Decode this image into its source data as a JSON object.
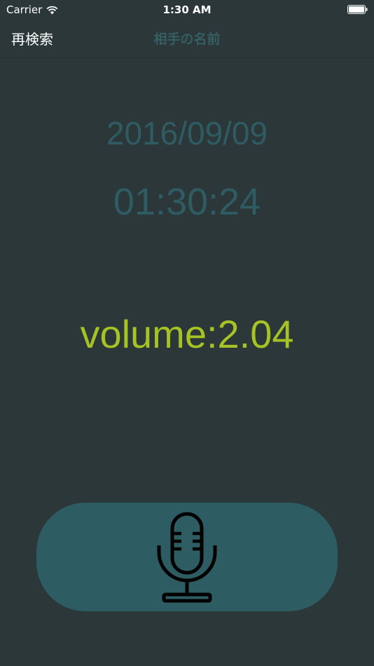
{
  "status_bar": {
    "carrier": "Carrier",
    "time": "1:30 AM",
    "wifi_icon": "wifi-icon",
    "battery_icon": "battery-icon"
  },
  "nav_bar": {
    "back_label": "再検索",
    "title": "相手の名前"
  },
  "main": {
    "date": "2016/09/09",
    "time": "01:30:24",
    "volume": "volume:2.04"
  },
  "record_button": {
    "icon": "microphone-icon"
  },
  "colors": {
    "background": "#2b3739",
    "accent_teal": "#2e5c63",
    "volume_green": "#a6c225",
    "title_teal": "#355e63"
  }
}
